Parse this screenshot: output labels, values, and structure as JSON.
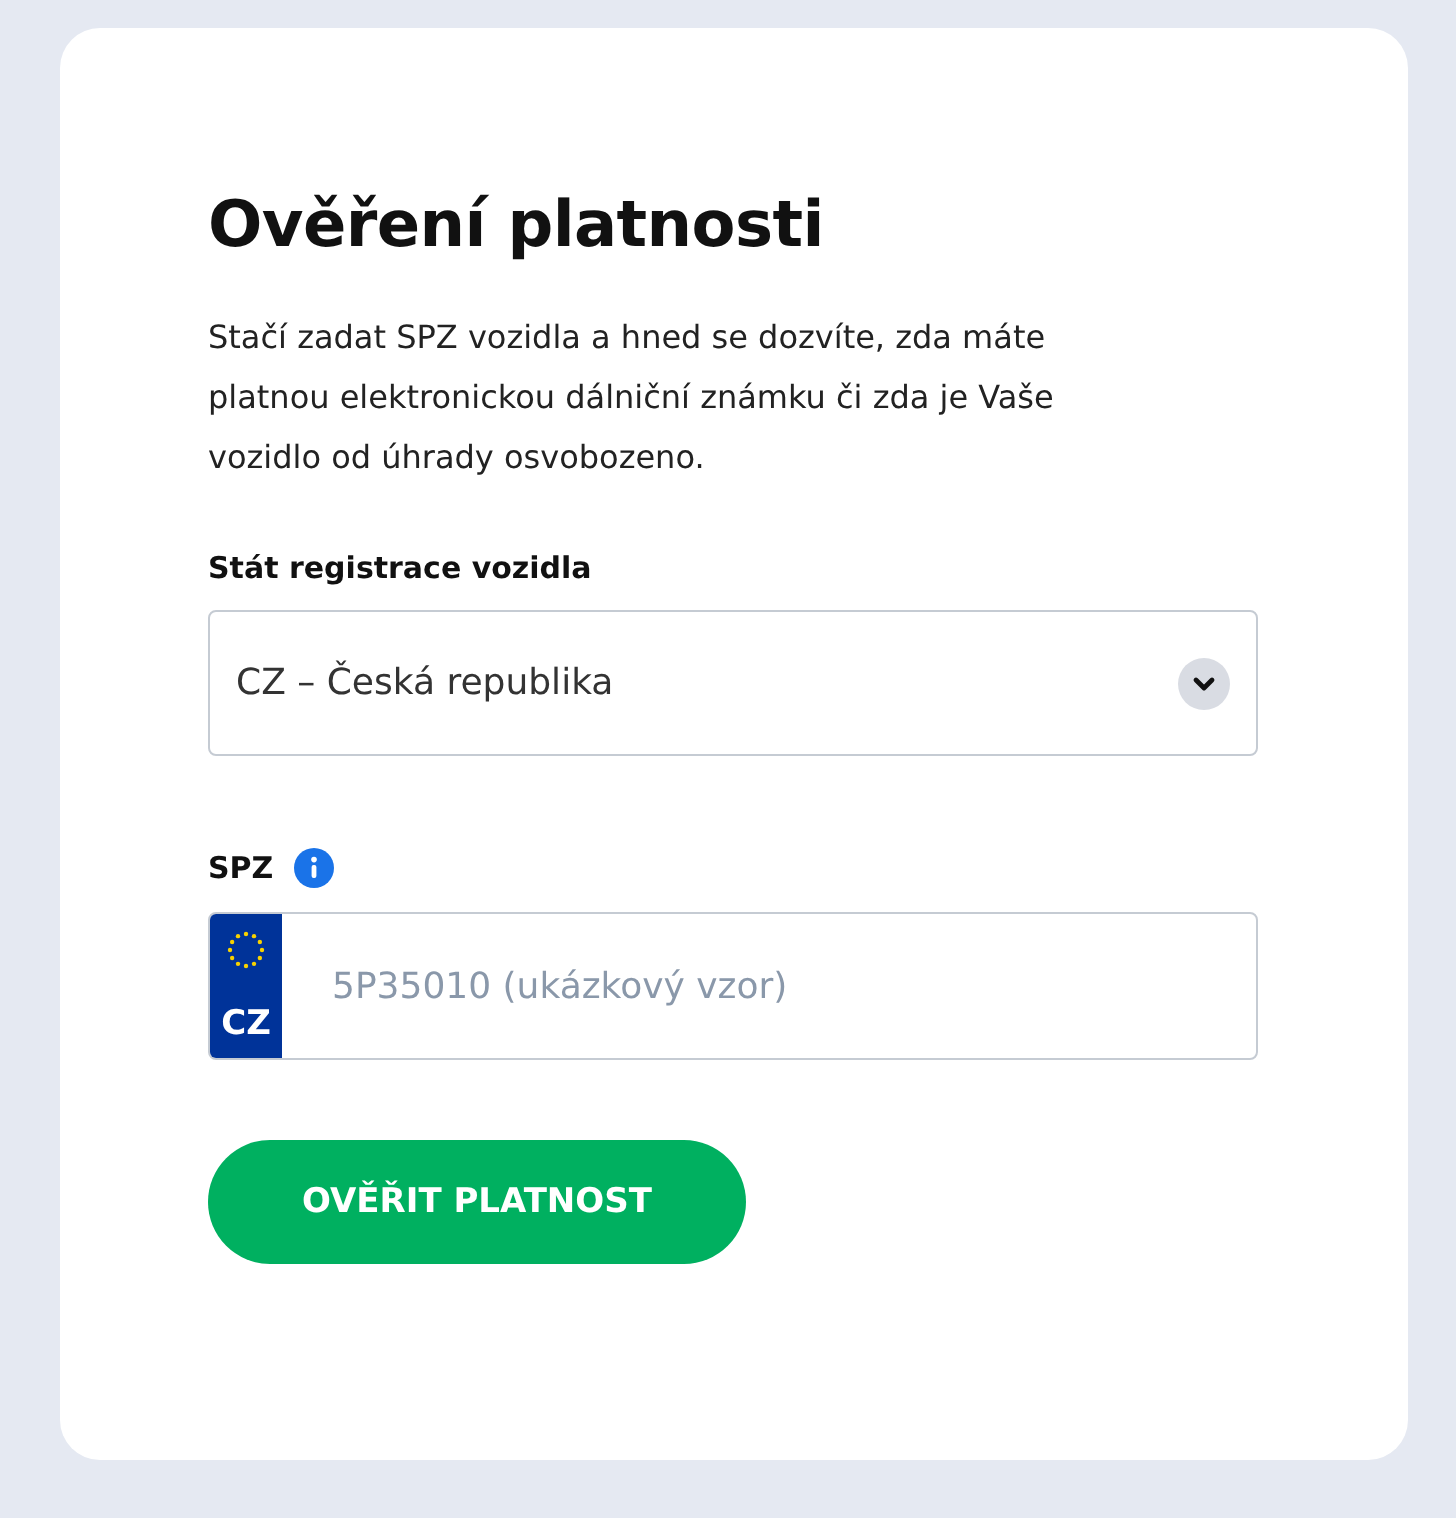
{
  "title": "Ověření platnosti",
  "description": "Stačí zadat SPZ vozidla a hned se dozvíte, zda máte platnou elektronickou dálniční známku či zda je Vaše vozidlo od úhrady osvobozeno.",
  "country_field": {
    "label": "Stát registrace vozidla",
    "value": "CZ – Česká republika"
  },
  "plate_field": {
    "label": "SPZ",
    "country_code": "CZ",
    "placeholder": "5P35010 (ukázkový vzor)"
  },
  "submit_button": {
    "label": "OVĚŘIT PLATNOST"
  }
}
